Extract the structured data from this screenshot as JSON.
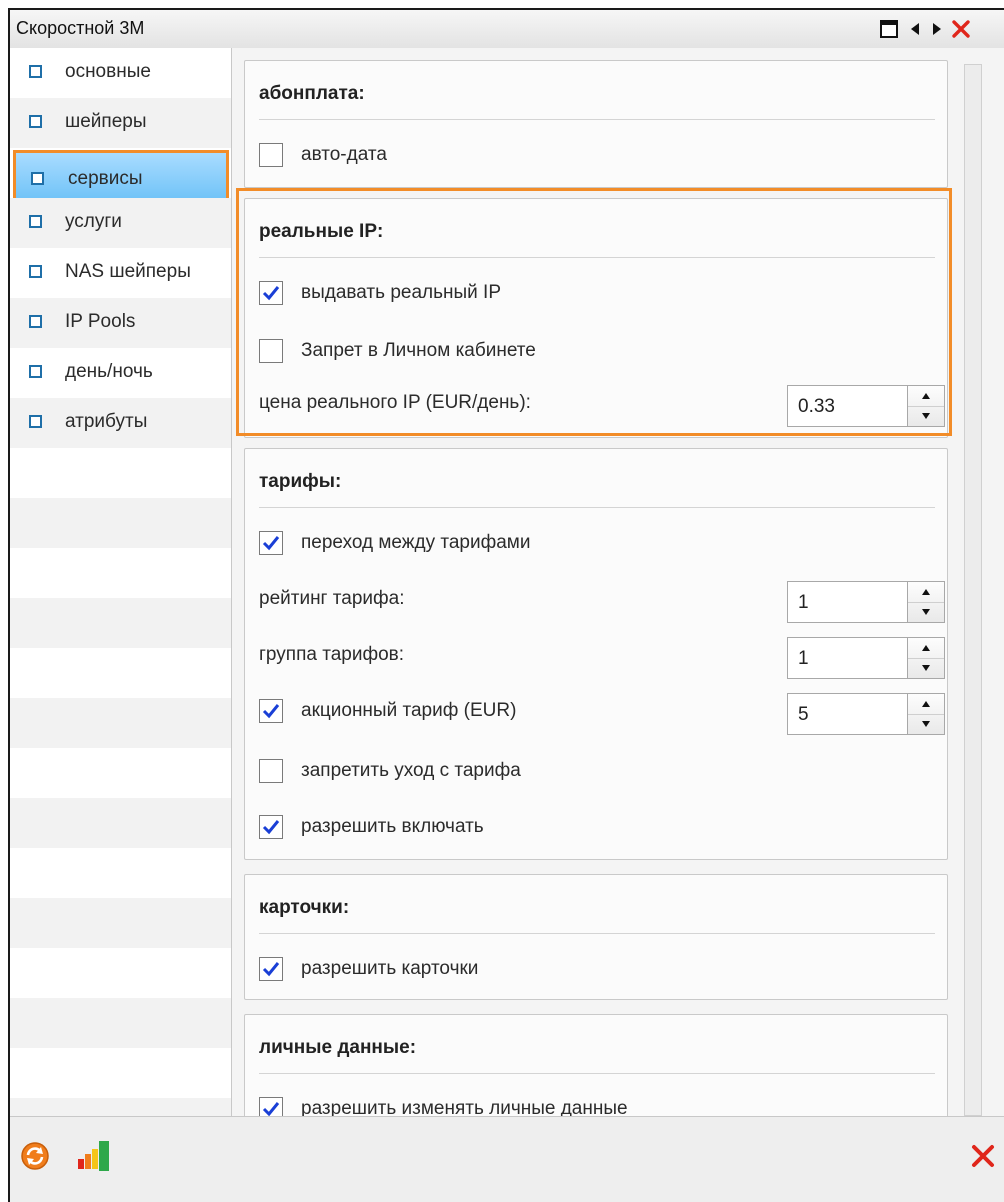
{
  "window": {
    "title": "Скоростной 3М"
  },
  "sidebar": {
    "items": [
      {
        "label": "основные"
      },
      {
        "label": "шейперы"
      },
      {
        "label": "сервисы",
        "active": true
      },
      {
        "label": "услуги"
      },
      {
        "label": "NAS шейперы"
      },
      {
        "label": "IP Pools"
      },
      {
        "label": "день/ночь"
      },
      {
        "label": "атрибуты"
      }
    ]
  },
  "sections": {
    "abonplata": {
      "title": "абонплата:",
      "auto_date": {
        "label": "авто-дата",
        "checked": false
      }
    },
    "real_ip": {
      "title": "реальные IP:",
      "issue_real_ip": {
        "label": "выдавать реальный IP",
        "checked": true
      },
      "ban_personal_cabinet": {
        "label": "Запрет в Личном кабинете",
        "checked": false
      },
      "price": {
        "label": "цена реального IP (EUR/день):",
        "value": "0.33"
      }
    },
    "tariffs": {
      "title": "тарифы:",
      "switch_tariffs": {
        "label": "переход между тарифами",
        "checked": true
      },
      "rating": {
        "label": "рейтинг тарифа:",
        "value": "1"
      },
      "group": {
        "label": "группа тарифов:",
        "value": "1"
      },
      "promo": {
        "label": "акционный тариф (EUR)",
        "checked": true,
        "value": "5"
      },
      "forbid_leave": {
        "label": "запретить уход с тарифа",
        "checked": false
      },
      "allow_enable": {
        "label": "разрешить включать",
        "checked": true
      }
    },
    "cards": {
      "title": "карточки:",
      "allow_cards": {
        "label": "разрешить карточки",
        "checked": true
      }
    },
    "personal": {
      "title": "личные данные:",
      "allow_edit": {
        "label": "разрешить изменять личные данные",
        "checked": true
      }
    }
  },
  "colors": {
    "accent_orange": "#f28c28",
    "selection_blue": "#6cc1f7",
    "check_blue": "#1a3fd6",
    "close_red": "#e0261b"
  },
  "icons": {
    "refresh": "refresh-icon",
    "stats": "stats-icon",
    "close": "close-icon"
  }
}
